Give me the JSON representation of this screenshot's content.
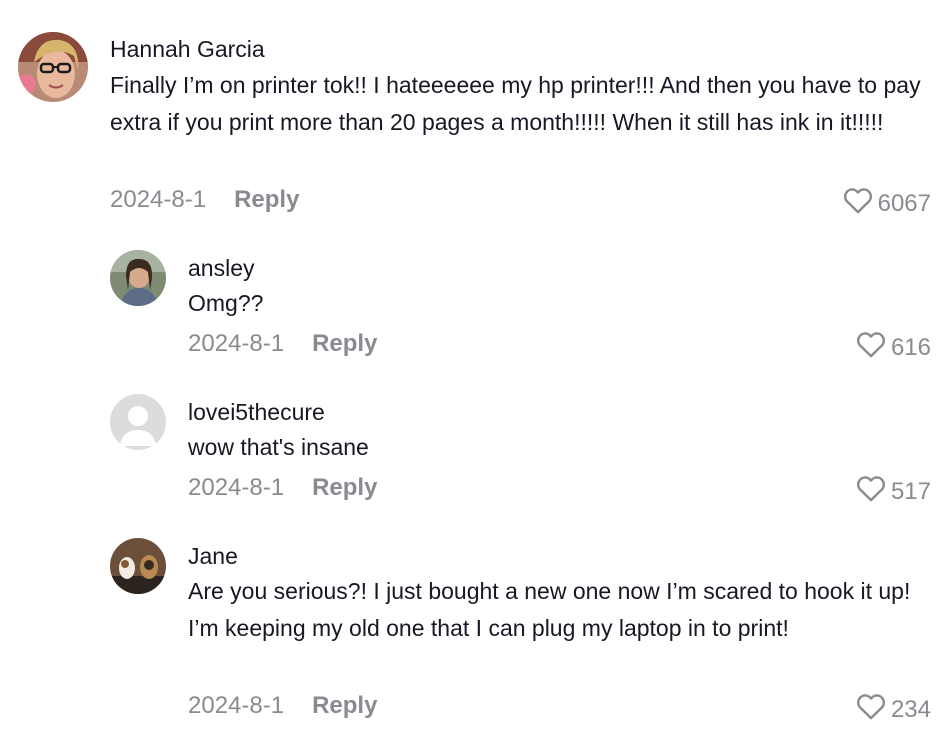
{
  "comments": [
    {
      "username": "Hannah Garcia",
      "text": "Finally I’m on printer tok!! I hateeeeee my hp printer!!! And then you have to pay extra if you print more than 20 pages a month!!!!! When it still has ink in it!!!!!",
      "date": "2024-8-1",
      "reply_label": "Reply",
      "likes": "6067"
    },
    {
      "username": "ansley",
      "text": "Omg??",
      "date": "2024-8-1",
      "reply_label": "Reply",
      "likes": "616"
    },
    {
      "username": "lovei5thecure",
      "text": "wow that's insane",
      "date": "2024-8-1",
      "reply_label": "Reply",
      "likes": "517"
    },
    {
      "username": "Jane",
      "text": "Are you serious?! I just bought a new one now I’m scared to hook it up! I’m keeping my old one that I can plug my laptop in to print!",
      "date": "2024-8-1",
      "reply_label": "Reply",
      "likes": "234"
    }
  ],
  "icons": {
    "like": "heart-outline-icon",
    "default_avatar": "user-placeholder-icon"
  },
  "colors": {
    "text_primary": "#161823",
    "text_secondary": "#8a8b91"
  }
}
